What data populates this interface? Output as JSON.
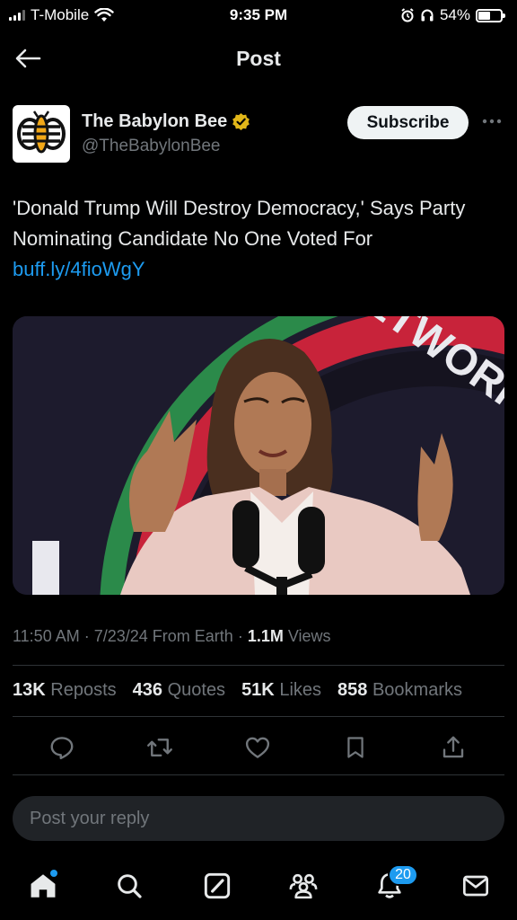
{
  "status_bar": {
    "carrier": "T-Mobile",
    "time": "9:35 PM",
    "battery": "54%",
    "battery_level": 0.54
  },
  "header": {
    "title": "Post"
  },
  "author": {
    "name": "The Babylon Bee",
    "handle": "@TheBabylonBee",
    "subscribe_label": "Subscribe"
  },
  "tweet": {
    "text": "'Donald Trump Will Destroy Democracy,' Says Party Nominating Candidate No One Voted For",
    "link": "buff.ly/4fioWgY"
  },
  "media": {
    "backdrop_text": "ETWORK"
  },
  "meta": {
    "time": "11:50 AM",
    "sep1": "·",
    "date": "7/23/24",
    "source": "From Earth",
    "sep2": "·",
    "views_count": "1.1M",
    "views_label": "Views"
  },
  "stats": [
    {
      "count": "13K",
      "label": "Reposts"
    },
    {
      "count": "436",
      "label": "Quotes"
    },
    {
      "count": "51K",
      "label": "Likes"
    },
    {
      "count": "858",
      "label": "Bookmarks"
    }
  ],
  "actions": [
    "reply-icon",
    "repost-icon",
    "like-icon",
    "bookmark-icon",
    "share-icon"
  ],
  "reply": {
    "placeholder": "Post your reply"
  },
  "nav": {
    "notification_count": "20"
  },
  "colors": {
    "accent": "#1d9bf0",
    "background": "#000000",
    "muted": "#71767b",
    "verified": "#e2b719"
  }
}
